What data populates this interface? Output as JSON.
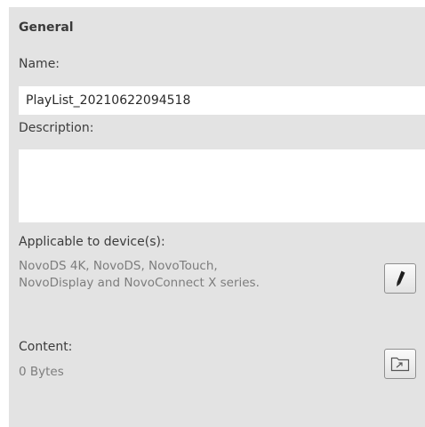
{
  "general": {
    "heading": "General",
    "name_label": "Name:",
    "name_value": "PlayList_20210622094518",
    "description_label": "Description:",
    "description_value": "",
    "applicable_label": "Applicable to device(s):",
    "applicable_line1": "NovoDS 4K, NovoDS, NovoTouch,",
    "applicable_line2": "NovoDisplay and NovoConnect X series.",
    "content_label": "Content:",
    "content_size": "0 Bytes"
  },
  "icons": {
    "edit": "pencil-icon",
    "content": "folder-icon"
  }
}
